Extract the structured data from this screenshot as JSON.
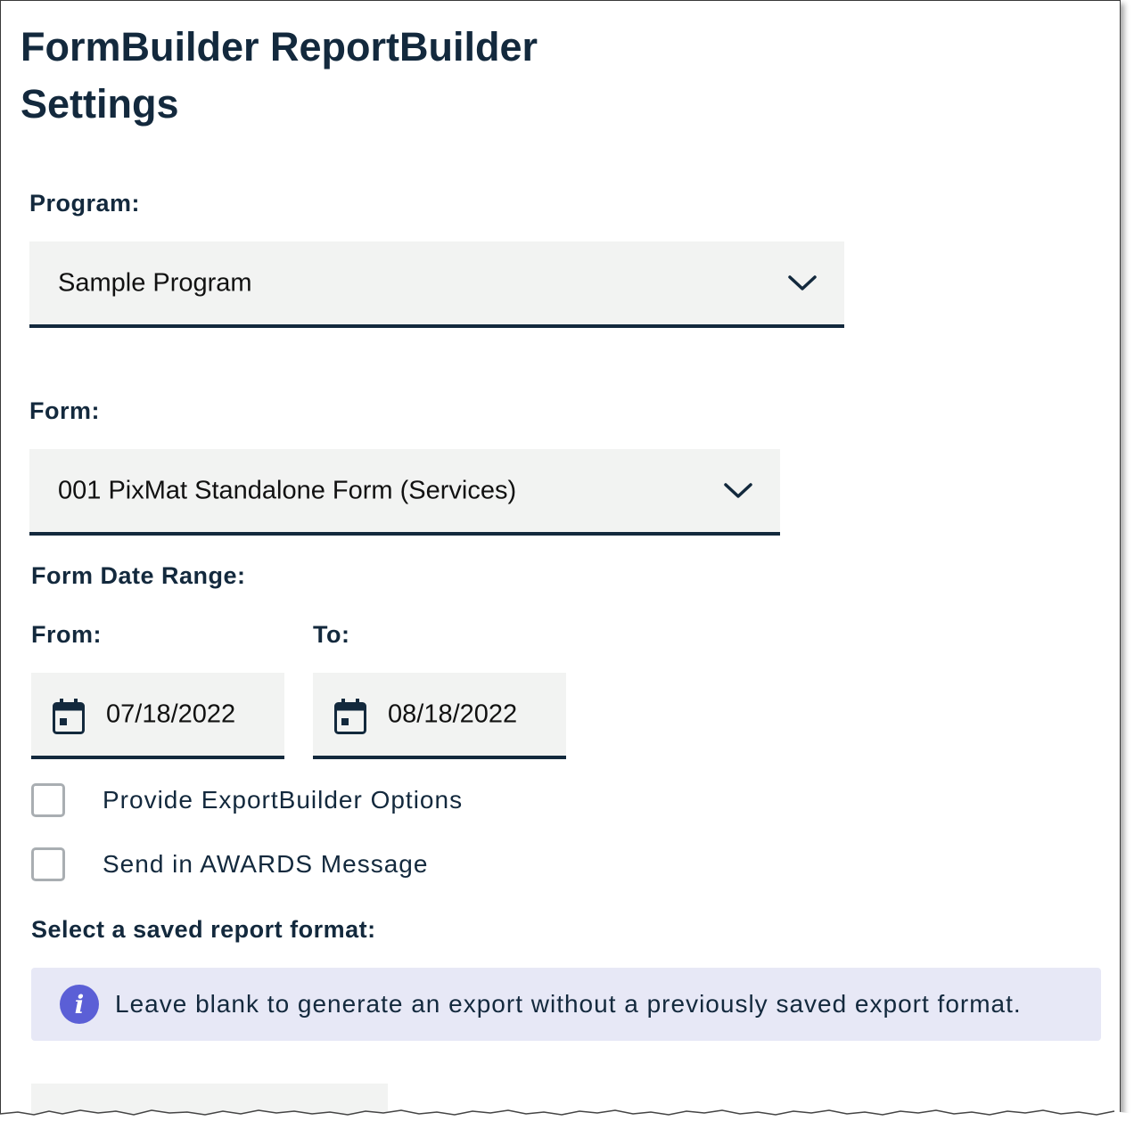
{
  "header": {
    "title_line1": "FormBuilder ReportBuilder",
    "title_line2": "Settings"
  },
  "program": {
    "label": "Program:",
    "selected": "Sample Program"
  },
  "form": {
    "label": "Form:",
    "selected": "001 PixMat Standalone Form (Services)"
  },
  "date_range": {
    "label": "Form Date Range:",
    "from_label": "From:",
    "to_label": "To:",
    "from_value": "07/18/2022",
    "to_value": "08/18/2022"
  },
  "options": [
    {
      "label": "Provide ExportBuilder Options",
      "checked": false
    },
    {
      "label": "Send in AWARDS Message",
      "checked": false
    }
  ],
  "saved_format": {
    "label": "Select a saved report format:",
    "info_text": "Leave blank to generate an export without a previously saved export format."
  },
  "colors": {
    "heading": "#13293d",
    "field_bg": "#f2f3f2",
    "info_bg": "#e7e8f6",
    "info_icon": "#5b5fd6"
  },
  "icons": [
    "chevron-down-icon",
    "calendar-icon",
    "info-icon"
  ]
}
